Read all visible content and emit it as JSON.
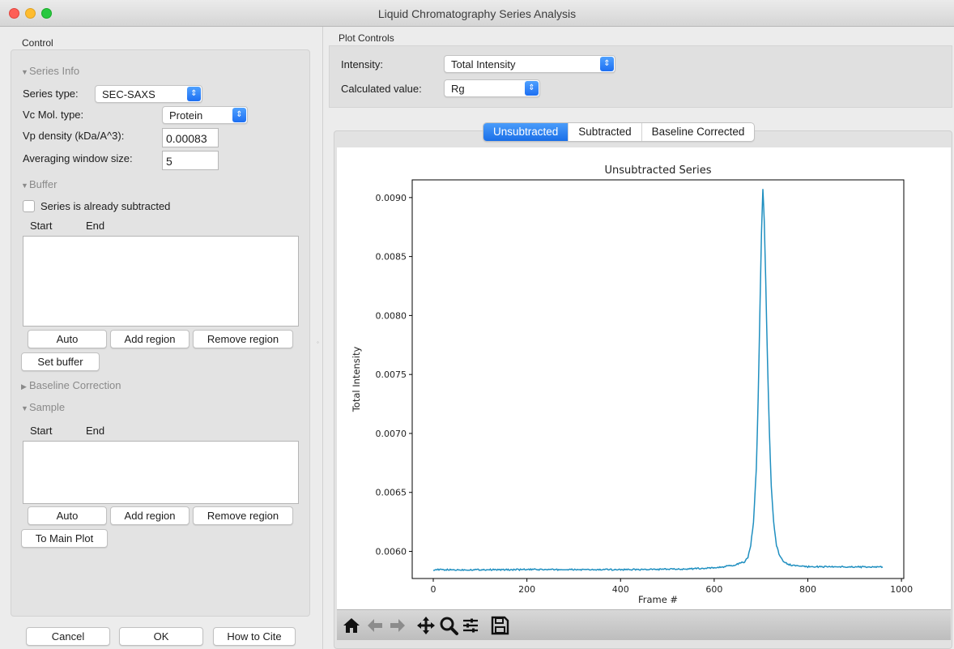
{
  "window": {
    "title": "Liquid Chromatography Series Analysis"
  },
  "control": {
    "heading": "Control",
    "series_info": {
      "header": "Series Info",
      "series_type_label": "Series type:",
      "series_type_value": "SEC-SAXS",
      "vc_mol_type_label": "Vc Mol. type:",
      "vc_mol_type_value": "Protein",
      "vp_density_label": "Vp density (kDa/A^3):",
      "vp_density_value": "0.00083",
      "avg_window_label": "Averaging window size:",
      "avg_window_value": "5"
    },
    "buffer": {
      "header": "Buffer",
      "subtracted_checkbox_label": "Series is already subtracted",
      "subtracted_checked": false,
      "col_start": "Start",
      "col_end": "End",
      "auto_label": "Auto",
      "add_region_label": "Add region",
      "remove_region_label": "Remove region",
      "set_buffer_label": "Set buffer"
    },
    "baseline": {
      "header": "Baseline Correction"
    },
    "sample": {
      "header": "Sample",
      "col_start": "Start",
      "col_end": "End",
      "auto_label": "Auto",
      "add_region_label": "Add region",
      "remove_region_label": "Remove region",
      "to_main_plot_label": "To Main Plot"
    }
  },
  "footer": {
    "cancel_label": "Cancel",
    "ok_label": "OK",
    "cite_label": "How to Cite"
  },
  "plot_controls": {
    "heading": "Plot Controls",
    "intensity_label": "Intensity:",
    "intensity_value": "Total Intensity",
    "calc_value_label": "Calculated value:",
    "calc_value_value": "Rg"
  },
  "tabs": [
    {
      "label": "Unsubtracted",
      "active": true
    },
    {
      "label": "Subtracted",
      "active": false
    },
    {
      "label": "Baseline Corrected",
      "active": false
    }
  ],
  "toolbar": {
    "icons": [
      "home-icon",
      "back-arrow-icon",
      "forward-arrow-icon",
      "pan-icon",
      "zoom-icon",
      "configure-subplots-icon",
      "save-icon"
    ]
  },
  "colors": {
    "accent": "#1a6fe8",
    "series_line": "#1f8fc0"
  },
  "chart_data": {
    "type": "line",
    "title": "Unsubtracted Series",
    "xlabel": "Frame #",
    "ylabel": "Total Intensity",
    "xlim": [
      -45,
      1005
    ],
    "ylim": [
      0.00577,
      0.00915
    ],
    "x_ticks": [
      "0",
      "200",
      "400",
      "600",
      "800",
      "1000"
    ],
    "y_ticks": [
      "0.0060",
      "0.0065",
      "0.0070",
      "0.0075",
      "0.0080",
      "0.0085",
      "0.0090"
    ],
    "grid": false,
    "series": [
      {
        "x": [
          0,
          50,
          100,
          150,
          200,
          250,
          300,
          350,
          400,
          450,
          500,
          550,
          600,
          620,
          640,
          655,
          665,
          672,
          678,
          684,
          690,
          694,
          698,
          701,
          704,
          707,
          710,
          714,
          718,
          722,
          727,
          733,
          740,
          748,
          758,
          770,
          785,
          800,
          830,
          860,
          900,
          930,
          960
        ],
        "y": [
          0.005845,
          0.005843,
          0.005845,
          0.005844,
          0.005846,
          0.005845,
          0.005845,
          0.005844,
          0.005846,
          0.005846,
          0.005848,
          0.005852,
          0.00586,
          0.00587,
          0.00588,
          0.0059,
          0.00591,
          0.00595,
          0.00605,
          0.00625,
          0.0067,
          0.0073,
          0.0081,
          0.0087,
          0.00907,
          0.0088,
          0.0083,
          0.0076,
          0.007,
          0.00655,
          0.00625,
          0.00605,
          0.00596,
          0.005915,
          0.00589,
          0.00588,
          0.005875,
          0.00587,
          0.00587,
          0.00587,
          0.005868,
          0.005868,
          0.005868
        ]
      }
    ]
  }
}
